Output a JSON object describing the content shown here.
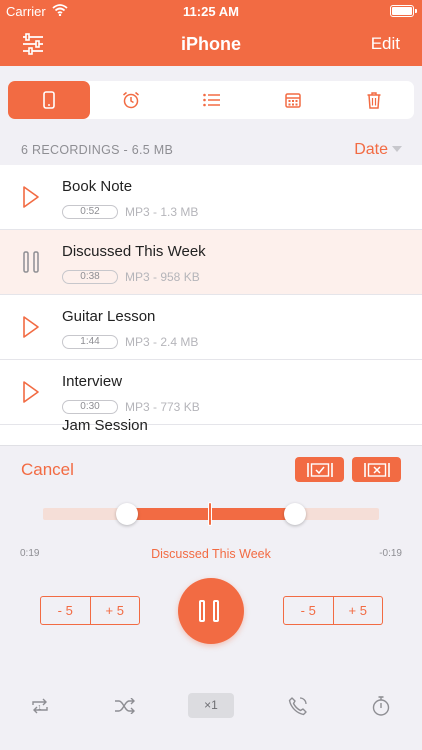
{
  "status_bar": {
    "carrier": "Carrier",
    "time": "11:25 AM"
  },
  "nav": {
    "title": "iPhone",
    "edit_label": "Edit"
  },
  "tabs": [
    {
      "icon": "phone-icon",
      "active": true
    },
    {
      "icon": "alarm-clock-icon",
      "active": false
    },
    {
      "icon": "list-icon",
      "active": false
    },
    {
      "icon": "calendar-icon",
      "active": false
    },
    {
      "icon": "trash-icon",
      "active": false
    }
  ],
  "list_header": {
    "summary": "6 RECORDINGS - 6.5 MB",
    "sort_label": "Date"
  },
  "recordings": [
    {
      "name": "Book Note",
      "duration": "0:52",
      "meta": "MP3 - 1.3 MB",
      "playing": false
    },
    {
      "name": "Discussed This Week",
      "duration": "0:38",
      "meta": "MP3 - 958 KB",
      "playing": true
    },
    {
      "name": "Guitar Lesson",
      "duration": "1:44",
      "meta": "MP3 - 2.4 MB",
      "playing": false
    },
    {
      "name": "Interview",
      "duration": "0:30",
      "meta": "MP3 - 773 KB",
      "playing": false
    },
    {
      "name": "Jam Session",
      "duration": "",
      "meta": "",
      "playing": false
    }
  ],
  "player": {
    "cancel_label": "Cancel",
    "elapsed": "0:19",
    "remaining": "-0:19",
    "now_playing": "Discussed This Week",
    "trim_start": 0.25,
    "trim_end": 0.75,
    "position": 0.5,
    "skip_left": [
      "- 5",
      "+ 5"
    ],
    "skip_right": [
      "- 5",
      "+ 5"
    ],
    "speed_label": "×1"
  },
  "colors": {
    "accent": "#f26b43",
    "background": "#f1f0f5",
    "highlight_row": "#fdf0ec"
  }
}
